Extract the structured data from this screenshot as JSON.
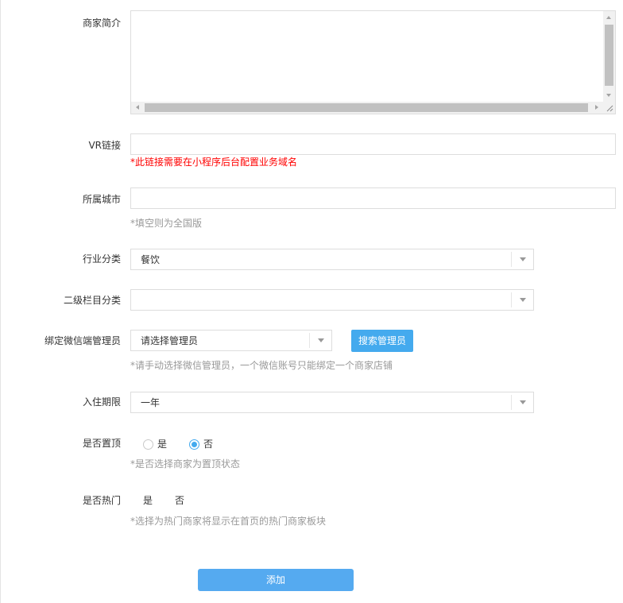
{
  "form": {
    "intro": {
      "label": "商家简介",
      "value": ""
    },
    "vr_link": {
      "label": "VR链接",
      "value": "",
      "hint": "*此链接需要在小程序后台配置业务域名"
    },
    "city": {
      "label": "所属城市",
      "value": "",
      "hint": "*填空则为全国版"
    },
    "industry": {
      "label": "行业分类",
      "selected": "餐饮"
    },
    "sub_category": {
      "label": "二级栏目分类",
      "selected": ""
    },
    "wechat_admin": {
      "label": "绑定微信端管理员",
      "selected": "请选择管理员",
      "search_button": "搜索管理员",
      "hint": "*请手动选择微信管理员，一个微信账号只能绑定一个商家店铺"
    },
    "term": {
      "label": "入住期限",
      "selected": "一年"
    },
    "pin_top": {
      "label": "是否置顶",
      "options": [
        "是",
        "否"
      ],
      "selected": "否",
      "hint": "*是否选择商家为置顶状态"
    },
    "hot": {
      "label": "是否热门",
      "options": [
        "是",
        "否"
      ],
      "hint": "*选择为热门商家将显示在首页的热门商家板块"
    },
    "submit_label": "添加"
  },
  "colors": {
    "primary_button": "#44aaee",
    "error_hint": "#ff0000",
    "muted_hint": "#999999",
    "border": "#dddddd"
  }
}
